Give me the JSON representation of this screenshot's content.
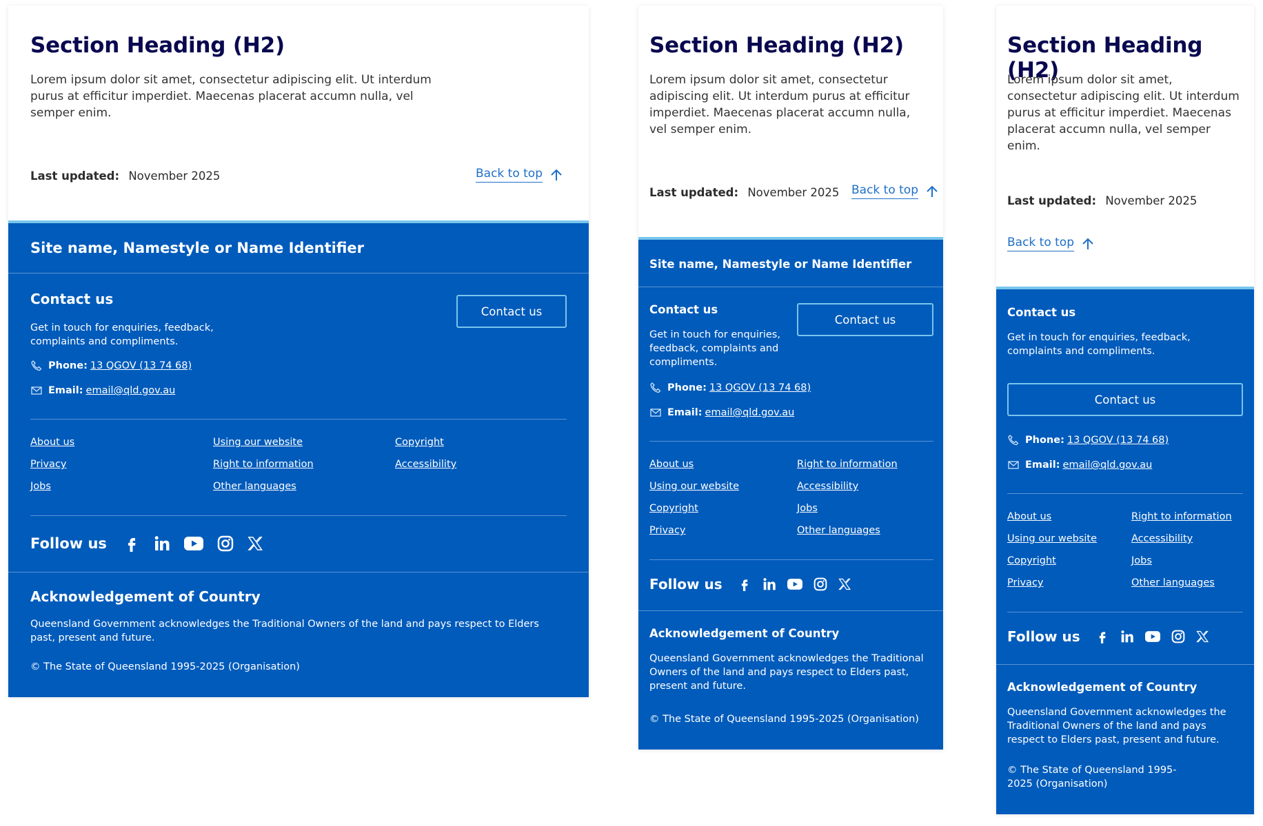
{
  "content": {
    "heading": "Section Heading (H2)",
    "lead": "Lorem ipsum dolor sit amet, consectetur adipiscing elit. Ut interdum purus at efficitur imperdiet. Maecenas placerat accumn nulla, vel semper enim.",
    "last_updated_label": "Last updated:",
    "last_updated_value": "November 2025",
    "back_to_top": "Back to top"
  },
  "footer": {
    "site_name": "Site name, Namestyle or Name Identifier",
    "contact_heading": "Contact us",
    "contact_text": "Get in touch for enquiries, feedback, complaints and compliments.",
    "contact_button": "Contact us",
    "phone_label": "Phone:",
    "phone_value": "13 QGOV (13 74 68)",
    "email_label": "Email:",
    "email_value": "email@qld.gov.au",
    "links": {
      "about": "About us",
      "using": "Using our website",
      "copyright": "Copyright",
      "privacy": "Privacy",
      "rti": "Right to information",
      "accessibility": "Accessibility",
      "jobs": "Jobs",
      "languages": "Other languages"
    },
    "follow_us": "Follow us",
    "social_icons": [
      "facebook-icon",
      "linkedin-icon",
      "youtube-icon",
      "instagram-icon",
      "x-icon"
    ],
    "ack_heading": "Acknowledgement of Country",
    "ack_text": "Queensland Government acknowledges the Traditional Owners of the land and pays respect to Elders past, present and future.",
    "copyright_text": "© The State of Queensland 1995-2025 (Organisation)"
  },
  "colors": {
    "footer_bg": "#005bbb",
    "heading": "#09084f",
    "link": "#1e6fc8",
    "accent_line": "#78c6ec"
  }
}
